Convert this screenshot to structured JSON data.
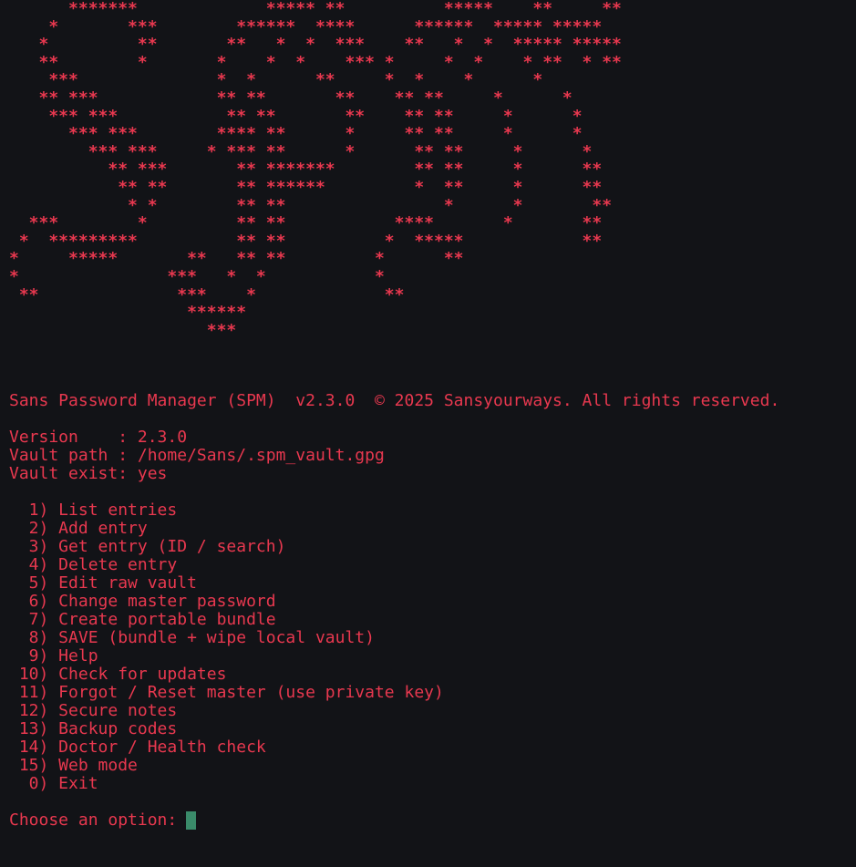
{
  "colors": {
    "background": "#121317",
    "text": "#e8384f",
    "cursor": "#3a8b6a"
  },
  "ascii_art": [
    "      *******             ***** **          *****    **     **",
    "    *       ***        ******  ****      ******  ***** *****",
    "   *         **       **   *  *  ***    **   *  *  ***** *****",
    "   **        *       *    *  *    *** *     *  *    * **  * **",
    "    ***              *  *      **     *  *    *      *",
    "   ** ***            ** **       **    ** **     *      *",
    "    *** ***           ** **       **    ** **     *      *",
    "      *** ***        **** **      *     ** **     *      *",
    "        *** ***     * *** **      *      ** **     *      *",
    "          ** ***       ** *******        ** **     *      **",
    "           ** **       ** ******         *  **     *      **",
    "            * *        ** **                *      *       **",
    "  ***        *         ** **           ****       *       **",
    " *  *********          ** **          *  *****            **",
    "*     *****       **   ** **         *      **",
    "*               ***   *  *           *",
    " **              ***    *             **",
    "                  ******",
    "                    ***"
  ],
  "header": {
    "title": "Sans Password Manager (SPM)  v2.3.0  © 2025 Sansyourways. All rights reserved."
  },
  "info": {
    "version": "Version    : 2.3.0",
    "vault_path": "Vault path : /home/Sans/.spm_vault.gpg",
    "vault_exist": "Vault exist: yes"
  },
  "menu": [
    "  1) List entries",
    "  2) Add entry",
    "  3) Get entry (ID / search)",
    "  4) Delete entry",
    "  5) Edit raw vault",
    "  6) Change master password",
    "  7) Create portable bundle",
    "  8) SAVE (bundle + wipe local vault)",
    "  9) Help",
    " 10) Check for updates",
    " 11) Forgot / Reset master (use private key)",
    " 12) Secure notes",
    " 13) Backup codes",
    " 14) Doctor / Health check",
    " 15) Web mode",
    "  0) Exit"
  ],
  "prompt": {
    "label": "Choose an option:"
  }
}
